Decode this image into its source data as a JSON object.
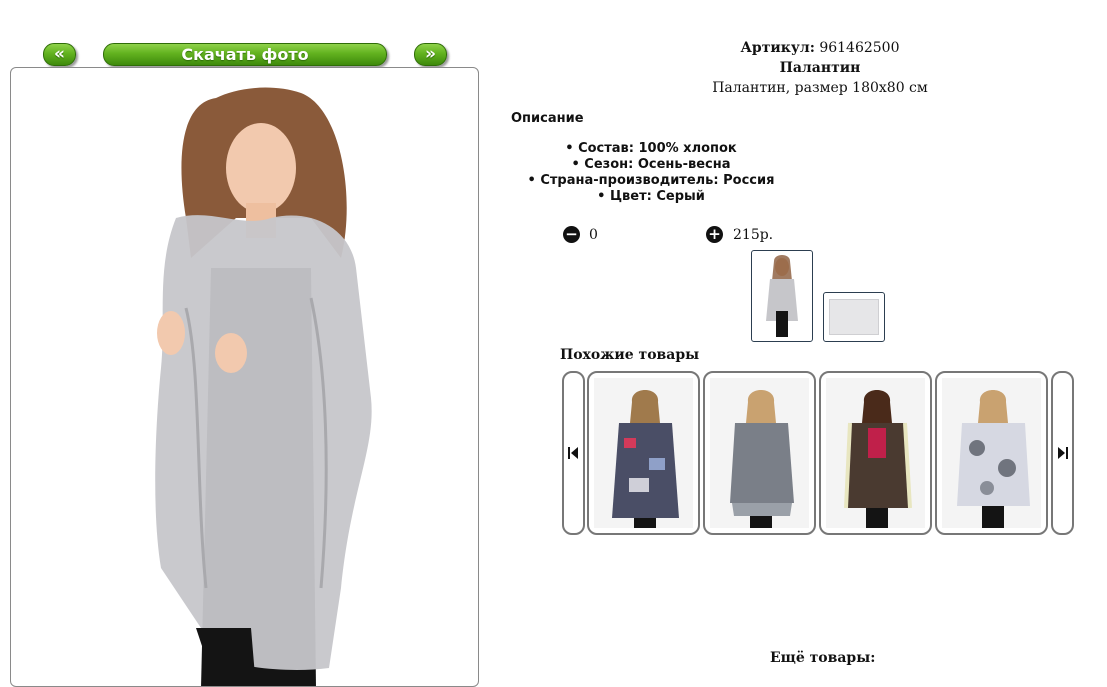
{
  "nav": {
    "prev_label": "«",
    "download_label": "Скачать фото",
    "next_label": "»"
  },
  "product": {
    "sku_label": "Артикул:",
    "sku_value": "961462500",
    "name": "Палантин",
    "subtitle": "Палантин, размер 180х80 см"
  },
  "description": {
    "title": "Описание",
    "items": [
      "Состав: 100% хлопок",
      "Сезон: Осень-весна",
      "Страна-производитель: Россия",
      "Цвет: Серый"
    ]
  },
  "order": {
    "quantity": "0",
    "price": "215р."
  },
  "similar": {
    "title": "Похожие товары"
  },
  "more": {
    "title": "Ещё товары:"
  },
  "colors": {
    "accent_green": "#62b21f",
    "shawl_gray": "#c5c5c8"
  }
}
